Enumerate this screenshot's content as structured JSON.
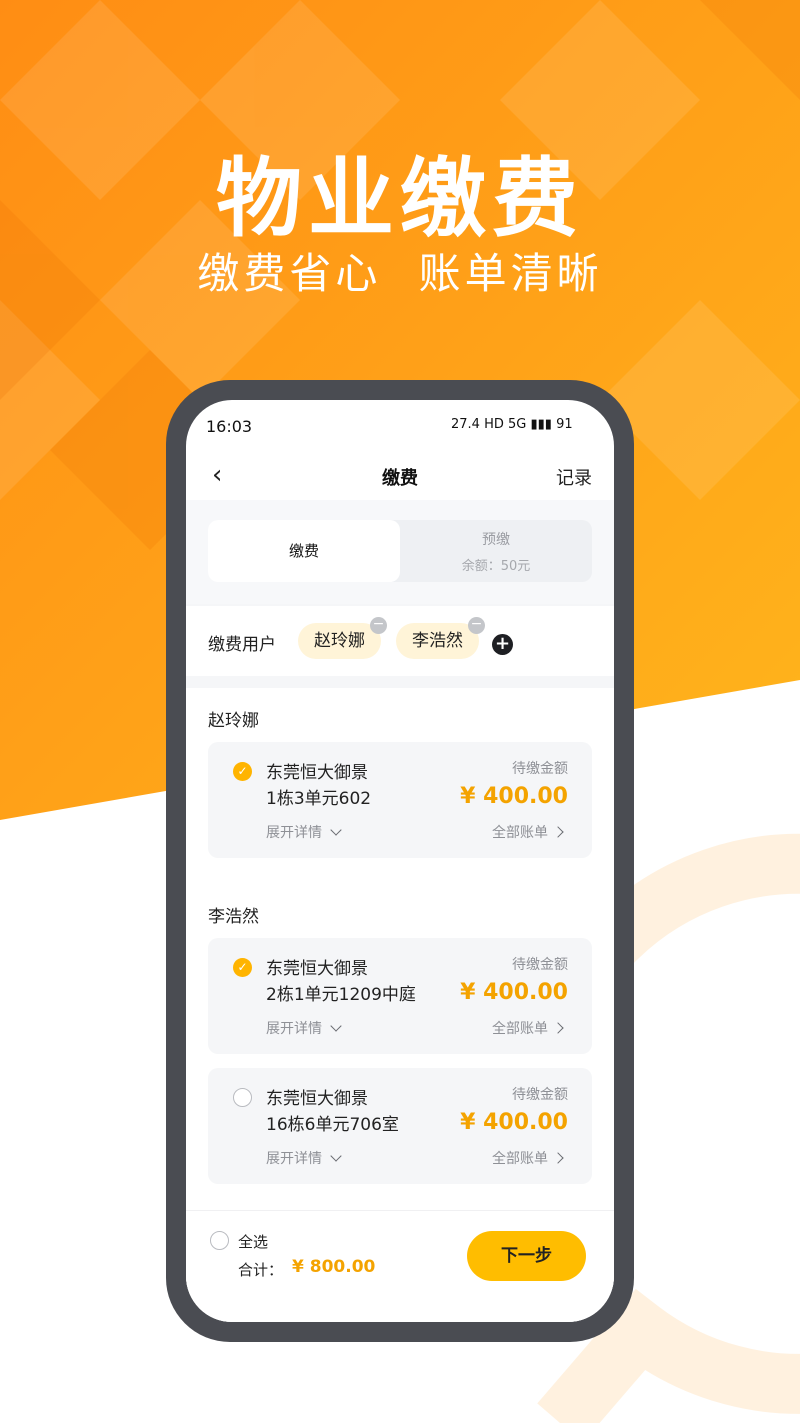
{
  "hero": {
    "title": "物业缴费",
    "subtitle": "缴费省心  账单清晰"
  },
  "colors": {
    "accent": "#ffb400",
    "amount": "#f4a300",
    "bg_orange": "#ff9a14"
  },
  "status_bar": {
    "time": "16:03",
    "indicators": "27.4 HD 5G ▮▮▮ 91"
  },
  "nav": {
    "back_icon": "chevron-left-icon",
    "title": "缴费",
    "record": "记录"
  },
  "tabs": {
    "pay": "缴费",
    "prepay": "预缴",
    "balance": "余额：50元"
  },
  "users": {
    "label": "缴费用户",
    "chips": [
      "赵玲娜",
      "李浩然"
    ],
    "remove_icon": "minus-icon",
    "add_icon": "plus-icon"
  },
  "groups": [
    {
      "name": "赵玲娜",
      "bills": [
        {
          "checked": true,
          "project": "东莞恒大御景",
          "address": "1栋3单元602",
          "due_label": "待缴金额",
          "amount": "¥ 400.00",
          "expand": "展开详情",
          "all_bills": "全部账单"
        }
      ]
    },
    {
      "name": "李浩然",
      "bills": [
        {
          "checked": true,
          "project": "东莞恒大御景",
          "address": "2栋1单元1209中庭",
          "due_label": "待缴金额",
          "amount": "¥ 400.00",
          "expand": "展开详情",
          "all_bills": "全部账单"
        },
        {
          "checked": false,
          "project": "东莞恒大御景",
          "address": "16栋6单元706室",
          "due_label": "待缴金额",
          "amount": "¥ 400.00",
          "expand": "展开详情",
          "all_bills": "全部账单"
        }
      ]
    }
  ],
  "footer": {
    "select_all": "全选",
    "total_label": "合计：",
    "total": "¥ 800.00",
    "next": "下一步"
  }
}
